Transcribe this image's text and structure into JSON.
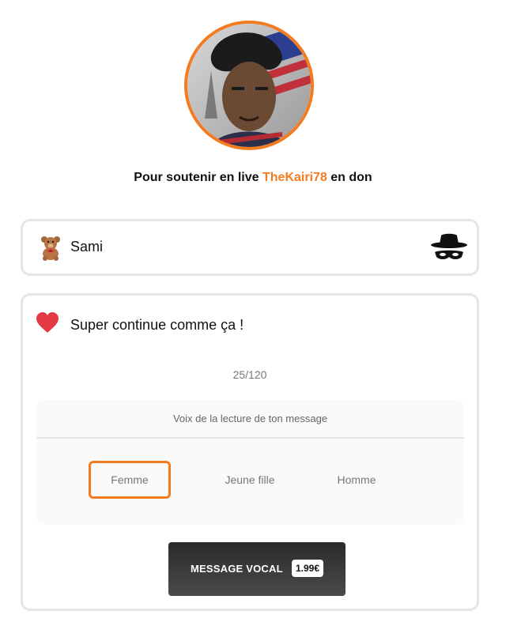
{
  "header": {
    "support_prefix": "Pour soutenir en live",
    "streamer_name": "TheKairi78",
    "support_suffix": "en don",
    "avatar_icon": "streamer-avatar"
  },
  "name_field": {
    "value": "Sami",
    "left_icon": "teddy-bear-icon",
    "right_icon": "incognito-hat-icon"
  },
  "message_field": {
    "icon": "heart-icon",
    "value": "Super continue comme ça !",
    "char_count": "25/120"
  },
  "voice": {
    "title": "Voix de la lecture de ton message",
    "options": [
      "Femme",
      "Jeune fille",
      "Homme"
    ],
    "selected": "Femme"
  },
  "submit": {
    "label": "MESSAGE VOCAL",
    "price": "1.99€"
  },
  "colors": {
    "accent": "#f47b20",
    "heart": "#e63946",
    "card_border": "#e6e6e6",
    "button_dark": "#333333"
  }
}
